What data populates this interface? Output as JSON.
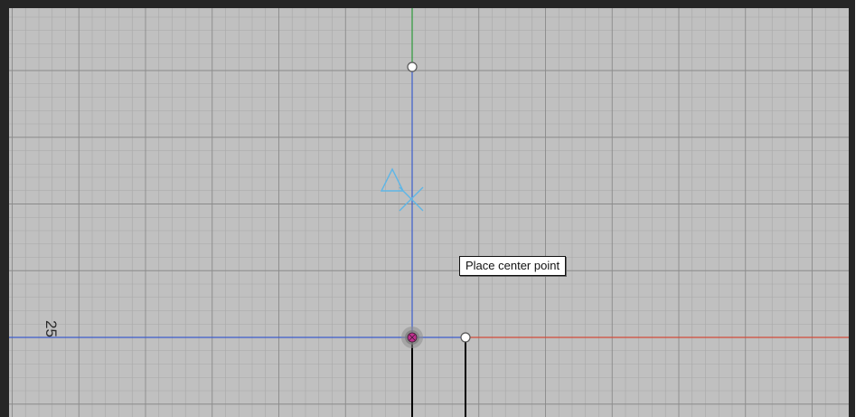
{
  "viewport": {
    "background_color": "#c0c0c0",
    "grid_minor_color": "#a8a8a8",
    "grid_major_color": "#8a8a8a"
  },
  "axes": {
    "x_positive_color": "#d24b3a",
    "x_negative_color": "#3c5ccc",
    "y_positive_color": "#2f9a3c",
    "z_color": "#000000"
  },
  "tooltip": {
    "text": "Place center point"
  },
  "dimension": {
    "value": "25"
  },
  "cursor": {
    "icon": "triangle-cross-cursor-icon",
    "color": "#5fb6e6"
  },
  "origin_marker": {
    "color": "#c0308f"
  },
  "handle_points": [
    "top-handle-point",
    "right-handle-point"
  ]
}
